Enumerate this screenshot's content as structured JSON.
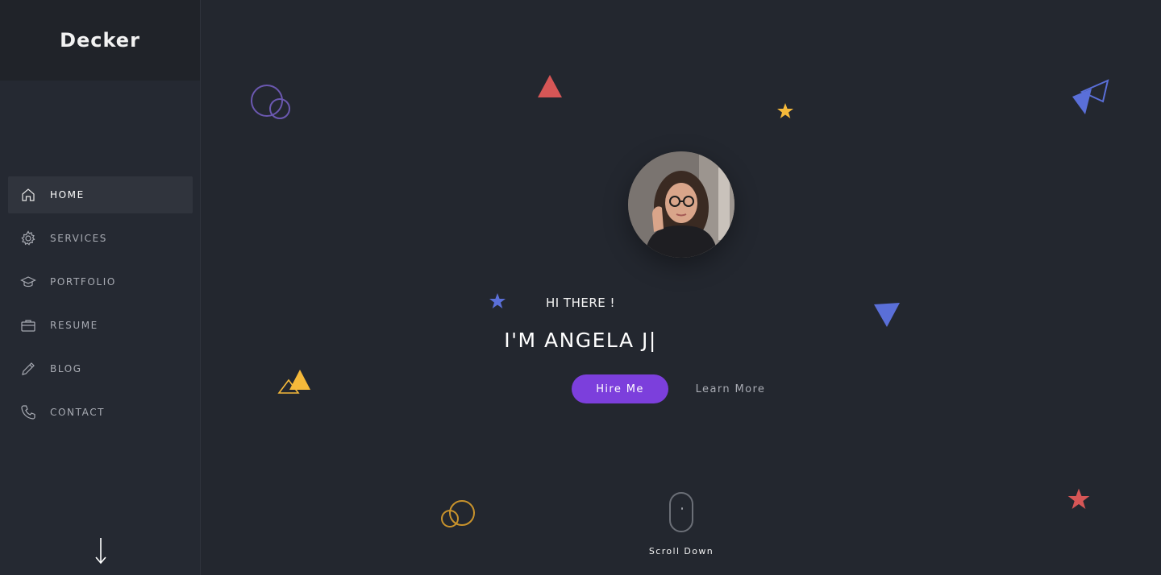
{
  "brand": {
    "name": "Decker"
  },
  "nav": {
    "items": [
      {
        "label": "HOME",
        "icon": "home-icon",
        "active": true
      },
      {
        "label": "SERVICES",
        "icon": "gear-icon",
        "active": false
      },
      {
        "label": "PORTFOLIO",
        "icon": "graduation-cap-icon",
        "active": false
      },
      {
        "label": "RESUME",
        "icon": "briefcase-icon",
        "active": false
      },
      {
        "label": "BLOG",
        "icon": "pencil-icon",
        "active": false
      },
      {
        "label": "CONTACT",
        "icon": "phone-icon",
        "active": false
      }
    ]
  },
  "hero": {
    "greeting": "HI THERE !",
    "name": "I'M ANGELA J|",
    "hire_label": "Hire Me",
    "learn_label": "Learn More",
    "scroll_label": "Scroll Down"
  },
  "colors": {
    "background": "#23272f",
    "sidebar": "#252932",
    "accent": "#7c3fdc",
    "red": "#d65656",
    "yellow": "#f5b93a",
    "blue": "#5a6fd8",
    "purple": "#6b58b0"
  }
}
